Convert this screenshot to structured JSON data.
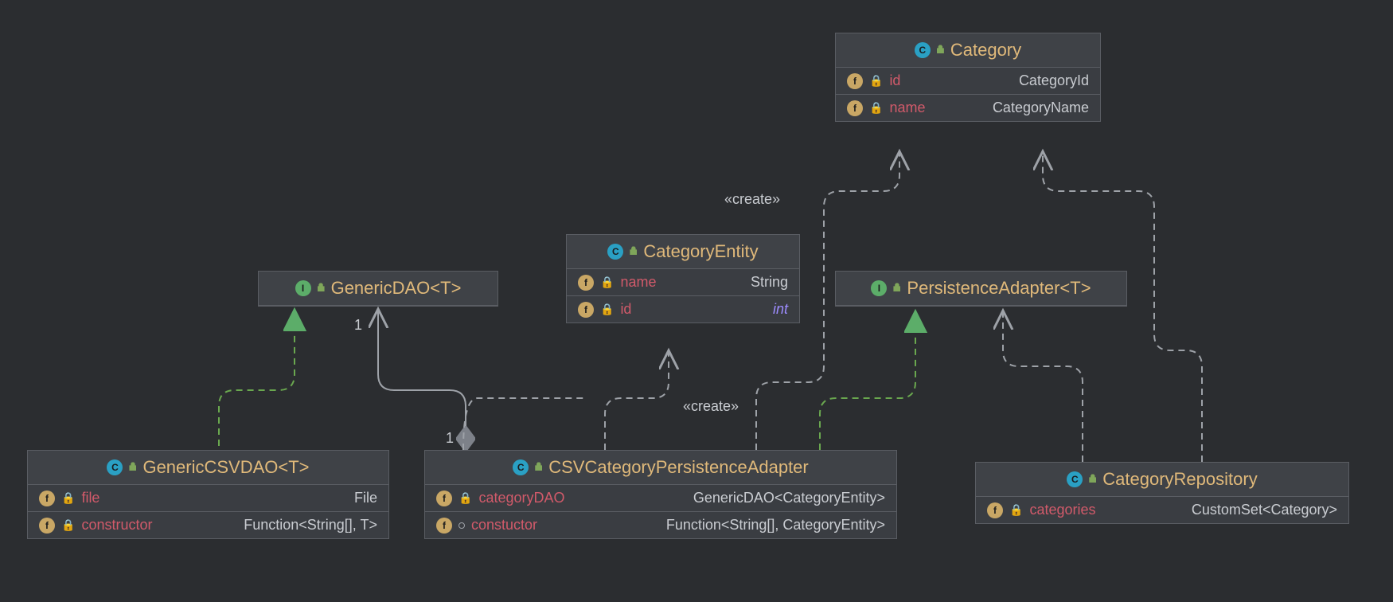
{
  "nodes": {
    "category": {
      "title": "Category",
      "kind": "class",
      "fields": [
        {
          "name": "id",
          "type": "CategoryId",
          "vis": "private"
        },
        {
          "name": "name",
          "type": "CategoryName",
          "vis": "private"
        }
      ]
    },
    "genericDAO": {
      "title": "GenericDAO<T>",
      "kind": "interface",
      "fields": []
    },
    "categoryEntity": {
      "title": "CategoryEntity",
      "kind": "class",
      "fields": [
        {
          "name": "name",
          "type": "String",
          "vis": "private"
        },
        {
          "name": "id",
          "type": "int",
          "vis": "private",
          "italic": true
        }
      ]
    },
    "persistenceAdapter": {
      "title": "PersistenceAdapter<T>",
      "kind": "interface",
      "fields": []
    },
    "genericCSVDAO": {
      "title": "GenericCSVDAO<T>",
      "kind": "class",
      "fields": [
        {
          "name": "file",
          "type": "File",
          "vis": "private"
        },
        {
          "name": "constructor",
          "type": "Function<String[], T>",
          "vis": "private"
        }
      ]
    },
    "csvCategoryPersistenceAdapter": {
      "title": "CSVCategoryPersistenceAdapter",
      "kind": "class",
      "fields": [
        {
          "name": "categoryDAO",
          "type": "GenericDAO<CategoryEntity>",
          "vis": "private"
        },
        {
          "name": "constuctor",
          "type": "Function<String[], CategoryEntity>",
          "vis": "package"
        }
      ]
    },
    "categoryRepository": {
      "title": "CategoryRepository",
      "kind": "class",
      "fields": [
        {
          "name": "categories",
          "type": "CustomSet<Category>",
          "vis": "private"
        }
      ]
    }
  },
  "labels": {
    "create1": "«create»",
    "create2": "«create»",
    "mult1a": "1",
    "mult1b": "1"
  },
  "relationships": [
    {
      "from": "genericCSVDAO",
      "to": "genericDAO",
      "type": "realization"
    },
    {
      "from": "csvCategoryPersistenceAdapter",
      "to": "genericDAO",
      "type": "aggregation",
      "mult_from": "1",
      "mult_to": "1"
    },
    {
      "from": "csvCategoryPersistenceAdapter",
      "to": "categoryEntity",
      "type": "dependency",
      "label": "«create»"
    },
    {
      "from": "csvCategoryPersistenceAdapter",
      "to": "persistenceAdapter",
      "type": "realization"
    },
    {
      "from": "csvCategoryPersistenceAdapter",
      "to": "category",
      "type": "dependency",
      "label": "«create»"
    },
    {
      "from": "categoryRepository",
      "to": "persistenceAdapter",
      "type": "dependency"
    },
    {
      "from": "categoryRepository",
      "to": "category",
      "type": "dependency"
    },
    {
      "from": "genericCSVDAO",
      "to": "categoryEntity",
      "type": "dependency"
    }
  ]
}
